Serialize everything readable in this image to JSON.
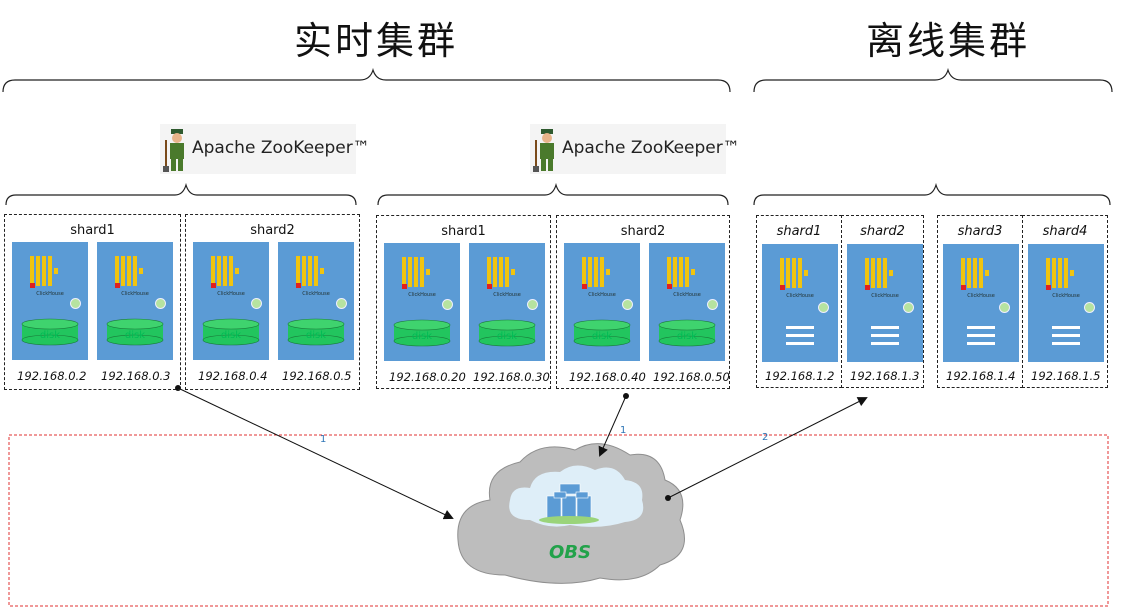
{
  "titles": {
    "realtime": "实时集群",
    "offline": "离线集群"
  },
  "zookeeper": {
    "label": "Apache ZooKeeper™"
  },
  "server": {
    "chlabel": "ClickHouse",
    "disk_label": "disk"
  },
  "realtime_shards": [
    {
      "label": "shard1",
      "ips": [
        "192.168.0.2",
        "192.168.0.3"
      ]
    },
    {
      "label": "shard2",
      "ips": [
        "192.168.0.4",
        "192.168.0.5"
      ]
    },
    {
      "label": "shard1",
      "ips": [
        "192.168.0.20",
        "192.168.0.30"
      ]
    },
    {
      "label": "shard2",
      "ips": [
        "192.168.0.40",
        "192.168.0.50"
      ]
    }
  ],
  "offline_shards": [
    {
      "label": "shard1",
      "ip": "192.168.1.2"
    },
    {
      "label": "shard2",
      "ip": "192.168.1.3"
    },
    {
      "label": "shard3",
      "ip": "192.168.1.4"
    },
    {
      "label": "shard4",
      "ip": "192.168.1.5"
    }
  ],
  "obs": {
    "label": "OBS"
  },
  "arrows": {
    "a1": "1",
    "a2": "1",
    "a3": "2"
  },
  "colors": {
    "server": "#5b9bd5",
    "bars": "#f1c40f",
    "disk": "#22c55e",
    "obs_text": "#22a24a",
    "region_border": "#e03030"
  }
}
